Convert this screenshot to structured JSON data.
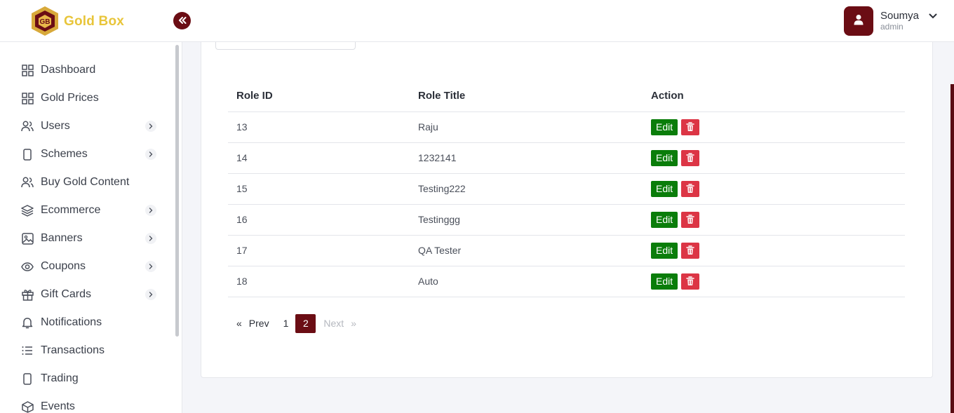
{
  "brand": {
    "name": "Gold Box"
  },
  "colors": {
    "primary": "#6b0d14",
    "brand_gold": "#e8c53a",
    "edit_green": "#0a7d0a",
    "delete_red": "#dc3545"
  },
  "user": {
    "name": "Soumya",
    "role": "admin"
  },
  "sidebar": {
    "items": [
      {
        "label": "Dashboard",
        "icon": "grid-icon",
        "has_submenu": false
      },
      {
        "label": "Gold Prices",
        "icon": "grid-icon",
        "has_submenu": false
      },
      {
        "label": "Users",
        "icon": "users-icon",
        "has_submenu": true
      },
      {
        "label": "Schemes",
        "icon": "phone-icon",
        "has_submenu": true
      },
      {
        "label": "Buy Gold Content",
        "icon": "users-icon",
        "has_submenu": false
      },
      {
        "label": "Ecommerce",
        "icon": "layers-icon",
        "has_submenu": true
      },
      {
        "label": "Banners",
        "icon": "image-icon",
        "has_submenu": true
      },
      {
        "label": "Coupons",
        "icon": "eye-icon",
        "has_submenu": true
      },
      {
        "label": "Gift Cards",
        "icon": "gift-icon",
        "has_submenu": true
      },
      {
        "label": "Notifications",
        "icon": "bell-icon",
        "has_submenu": false
      },
      {
        "label": "Transactions",
        "icon": "list-icon",
        "has_submenu": false
      },
      {
        "label": "Trading",
        "icon": "phone-icon",
        "has_submenu": false
      },
      {
        "label": "Events",
        "icon": "box-icon",
        "has_submenu": false
      }
    ]
  },
  "table": {
    "headers": {
      "id": "Role ID",
      "title": "Role Title",
      "action": "Action"
    },
    "edit_label": "Edit",
    "rows": [
      {
        "id": "13",
        "title": "Raju"
      },
      {
        "id": "14",
        "title": "1232141"
      },
      {
        "id": "15",
        "title": "Testing222"
      },
      {
        "id": "16",
        "title": "Testinggg"
      },
      {
        "id": "17",
        "title": "QA Tester"
      },
      {
        "id": "18",
        "title": "Auto"
      }
    ]
  },
  "pagination": {
    "prev_arrow": "«",
    "prev_label": "Prev",
    "pages": [
      "1",
      "2"
    ],
    "current": "2",
    "next_label": "Next",
    "next_arrow": "»"
  }
}
